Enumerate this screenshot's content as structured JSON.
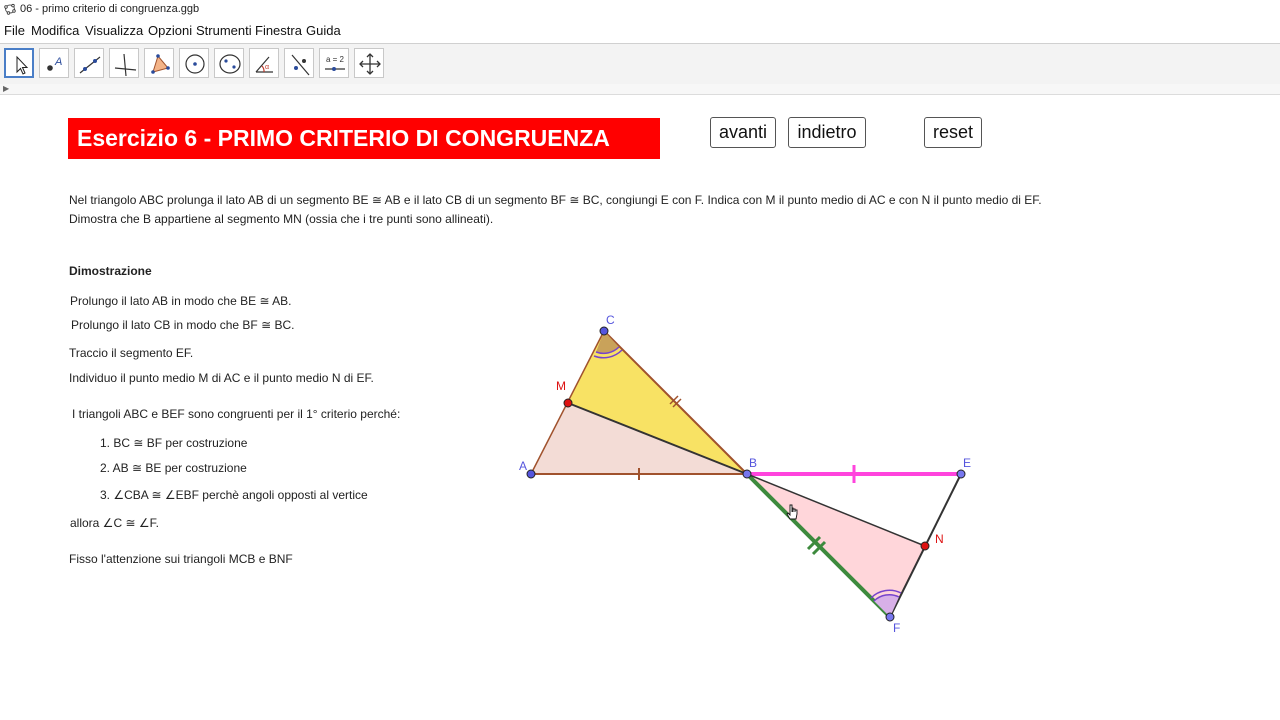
{
  "window": {
    "title": "06 - primo criterio di congruenza.ggb"
  },
  "menu": [
    "File",
    "Modifica",
    "Visualizza",
    "Opzioni",
    "Strumenti",
    "Finestra",
    "Guida"
  ],
  "toolbar": {
    "tools": [
      "move-tool",
      "point-tool",
      "line-tool",
      "perpendicular-tool",
      "polygon-tool",
      "circle-tool",
      "conic-tool",
      "angle-tool",
      "reflect-tool",
      "slider-tool",
      "move-view-tool"
    ],
    "slider_label": "a = 2"
  },
  "heading": "Esercizio 6 - PRIMO CRITERIO DI CONGRUENZA",
  "buttons": {
    "avanti": "avanti",
    "indietro": "indietro",
    "reset": "reset"
  },
  "statement": {
    "line1": "Nel triangolo ABC prolunga il lato AB di un segmento BE ≅ AB e il lato CB di un segmento BF ≅ BC, congiungi E con F. Indica con M il punto medio di AC e con N il punto medio di EF.",
    "line2": "Dimostra che B appartiene al segmento MN (ossia che i tre punti sono allineati)."
  },
  "proof": {
    "title": "Dimostrazione",
    "step1": "Prolungo il lato AB in modo che BE ≅ AB.",
    "step2": "Prolungo il lato CB in modo che BF ≅ BC.",
    "step3": "Traccio il segmento EF.",
    "step4": "Individuo il punto medio M di AC e il punto medio N di EF.",
    "claim": "I triangoli ABC e BEF sono congruenti per il 1° criterio perché:",
    "item1": "1. BC ≅ BF per costruzione",
    "item2": "2. AB ≅ BE per costruzione",
    "item3": "3. ∠CBA ≅ ∠EBF perchè angoli opposti al vertice",
    "conclusion": "allora ∠C ≅ ∠F.",
    "focus": "Fisso l'attenzione sui triangoli MCB e BNF"
  },
  "figure": {
    "labels": {
      "A": "A",
      "B": "B",
      "C": "C",
      "E": "E",
      "F": "F",
      "M": "M",
      "N": "N"
    },
    "colors": {
      "triangle_fill": "#f3dcd6",
      "mcb_fill": "#f8e264",
      "bnf_fill": "#ffd6da",
      "be_segment": "#ff44dd",
      "bf_segment": "#3d8a3d",
      "point_blue": "#5555dd",
      "point_red": "#dd1111",
      "edge": "#a0522d",
      "angle_arc": "#7744cc"
    }
  }
}
